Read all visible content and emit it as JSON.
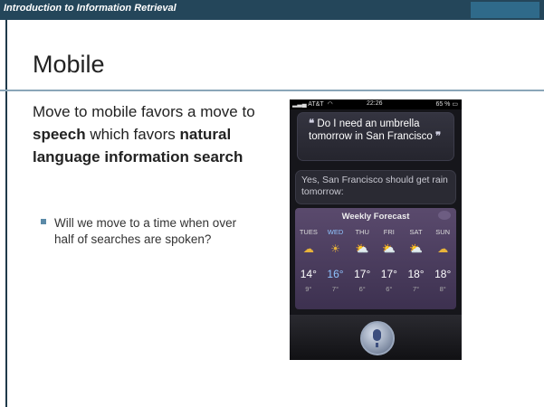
{
  "header": {
    "course_title": "Introduction to Information Retrieval"
  },
  "slide": {
    "title": "Mobile",
    "body": [
      {
        "text": "Move to mobile favors a move to ",
        "bold": false
      },
      {
        "text": "speech",
        "bold": true
      },
      {
        "text": " which favors ",
        "bold": false
      },
      {
        "text": "natural language information search",
        "bold": true
      }
    ],
    "bullet": "Will we move to a time when over half of searches are spoken?"
  },
  "phone": {
    "status": {
      "carrier": "AT&T",
      "time": "22:26",
      "battery": "65 %"
    },
    "query": {
      "open_quote": "❝",
      "text": "Do I need an umbrella tomorrow in San Francisco",
      "close_quote": "❞"
    },
    "reply": "Yes, San Francisco should get rain tomorrow:",
    "forecast": {
      "title": "Weekly Forecast",
      "days": [
        {
          "day": "TUES",
          "high": "14°",
          "low": "9°",
          "icon": "rain-cloud-icon",
          "active": false
        },
        {
          "day": "WED",
          "high": "16°",
          "low": "7°",
          "icon": "sun-icon",
          "active": true
        },
        {
          "day": "THU",
          "high": "17°",
          "low": "6°",
          "icon": "partly-sunny-icon",
          "active": false
        },
        {
          "day": "FRI",
          "high": "17°",
          "low": "6°",
          "icon": "partly-sunny-icon",
          "active": false
        },
        {
          "day": "SAT",
          "high": "18°",
          "low": "7°",
          "icon": "partly-sunny-icon",
          "active": false
        },
        {
          "day": "SUN",
          "high": "18°",
          "low": "8°",
          "icon": "rain-cloud-icon",
          "active": false
        }
      ]
    }
  }
}
